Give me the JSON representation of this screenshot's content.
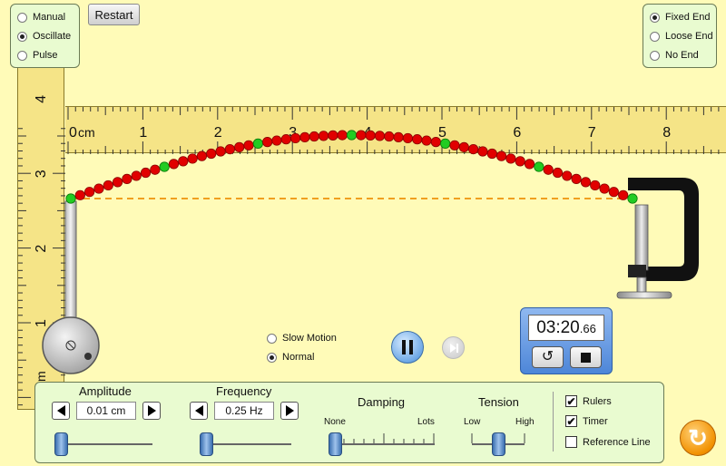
{
  "mode": {
    "options": [
      {
        "label": "Manual",
        "selected": false
      },
      {
        "label": "Oscillate",
        "selected": true
      },
      {
        "label": "Pulse",
        "selected": false
      }
    ]
  },
  "restart_label": "Restart",
  "end": {
    "options": [
      {
        "label": "Fixed End",
        "selected": true
      },
      {
        "label": "Loose End",
        "selected": false
      },
      {
        "label": "No End",
        "selected": false
      }
    ]
  },
  "ruler_h": {
    "unit": "cm",
    "ticks": [
      "0",
      "1",
      "2",
      "3",
      "4",
      "5",
      "6",
      "7",
      "8"
    ]
  },
  "ruler_v": {
    "unit": "cm",
    "ticks": [
      "1",
      "2",
      "3",
      "4"
    ]
  },
  "speed": {
    "options": [
      {
        "label": "Slow Motion",
        "selected": false
      },
      {
        "label": "Normal",
        "selected": true
      }
    ]
  },
  "timer": {
    "main": "03:20",
    "fraction": ".66"
  },
  "controls": {
    "amplitude": {
      "label": "Amplitude",
      "value": "0.01 cm",
      "level": 0.0
    },
    "frequency": {
      "label": "Frequency",
      "value": "0.25 Hz",
      "level": 0.0
    },
    "damping": {
      "label": "Damping",
      "min_label": "None",
      "max_label": "Lots",
      "level": 0.0
    },
    "tension": {
      "label": "Tension",
      "min_label": "Low",
      "max_label": "High",
      "level": 0.5
    }
  },
  "options": {
    "rulers": {
      "label": "Rulers",
      "checked": true
    },
    "timer": {
      "label": "Timer",
      "checked": true
    },
    "reference_line": {
      "label": "Reference Line",
      "checked": false
    }
  },
  "colors": {
    "bead": "#e10000",
    "bead_marker": "#22cc22",
    "reference": "#f0a020",
    "panel": "#e9fbd0"
  }
}
